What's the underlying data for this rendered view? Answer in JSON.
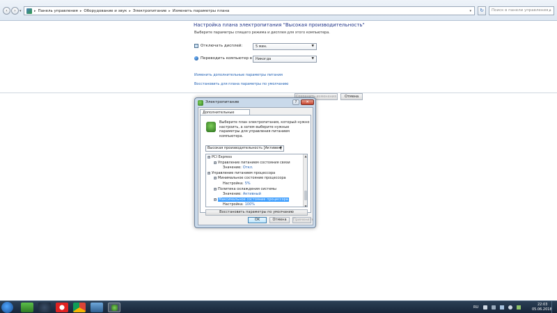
{
  "explorer": {
    "breadcrumbs": [
      "Панель управления",
      "Оборудование и звук",
      "Электропитание",
      "Изменить параметры плана"
    ],
    "search_placeholder": "Поиск в панели управления",
    "refresh_glyph": "↻",
    "dropdown_glyph": "▾",
    "back_glyph": "‹",
    "forward_glyph": "›"
  },
  "page": {
    "title": "Настройка плана электропитания \"Высокая производительность\"",
    "subtitle": "Выберите параметры спящего режима и дисплея для этого компьютера.",
    "display_off_label": "Отключать дисплей:",
    "display_off_value": "5 мин.",
    "sleep_label": "Переводить компьютер в спящий режим:",
    "sleep_value": "Никогда",
    "link_advanced": "Изменить дополнительные параметры питания",
    "link_restore": "Восстановить для плана параметры по умолчанию",
    "save_button": "Сохранить изменения",
    "cancel_button": "Отмена"
  },
  "dialog": {
    "title": "Электропитание",
    "help_glyph": "?",
    "close_glyph": "✕",
    "tab_label": "Дополнительные параметры",
    "description": "Выберите план электропитания, который нужно настроить, а затем выберите нужные параметры для управления питанием компьютера.",
    "plan_value": "Высокая производительность [Активен]",
    "tree": [
      {
        "text": "PCI Express",
        "indent": 0,
        "exp": "⊟"
      },
      {
        "text": "Управление питанием состояния связи",
        "indent": 1,
        "exp": "⊟"
      },
      {
        "label": "Значение:",
        "value": "Откл.",
        "indent": 2
      },
      {
        "text": "Управление питанием процессора",
        "indent": 0,
        "exp": "⊟"
      },
      {
        "text": "Минимальное состояние процессора",
        "indent": 1,
        "exp": "⊟"
      },
      {
        "label": "Настройка:",
        "value": "5%",
        "indent": 2
      },
      {
        "text": "Политика охлаждения системы",
        "indent": 1,
        "exp": "⊟"
      },
      {
        "label": "Значение:",
        "value": "Активный",
        "indent": 2
      },
      {
        "text": "Максимальное состояние процессора",
        "indent": 1,
        "exp": "⊟",
        "selected": true
      },
      {
        "label": "Настройка:",
        "value": "100%",
        "indent": 2
      },
      {
        "text": "Экран",
        "indent": 0,
        "exp": "⊞"
      }
    ],
    "restore_button": "Восстановить параметры по умолчанию",
    "ok_button": "OK",
    "cancel_button": "Отмена",
    "apply_button": "Применить"
  },
  "taskbar": {
    "lang": "RU",
    "time": "22:03",
    "date": "05.06.2018"
  },
  "colors": {
    "link": "#1e5fb4",
    "title": "#1e3287",
    "selection": "#3399ff"
  }
}
